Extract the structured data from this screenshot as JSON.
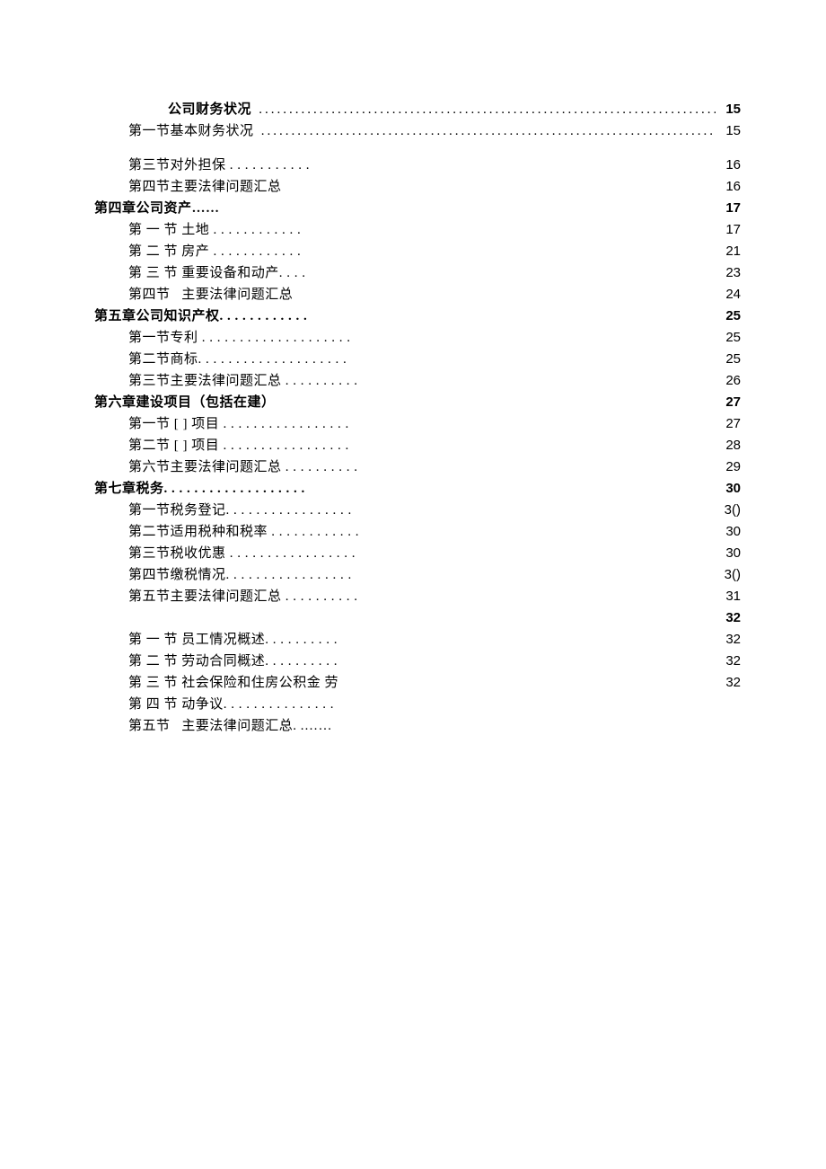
{
  "entries": [
    {
      "type": "main-center",
      "label": "公司财务状况 ",
      "leader": "full",
      "page": "15"
    },
    {
      "type": "sub-center",
      "label": "第一节基本财务状况 ",
      "leader": "full",
      "page": "15"
    },
    {
      "type": "spacer"
    },
    {
      "type": "sub",
      "label": "第三节对外担保 . . . . . . . . . . .",
      "leader": "short",
      "page": "16"
    },
    {
      "type": "sub",
      "label": "第四节主要法律问题汇总",
      "leader": "short",
      "page": "16"
    },
    {
      "type": "main",
      "label": "第四章公司资产……",
      "leader": "short",
      "page": "17"
    },
    {
      "type": "sub",
      "label": "第 一 节 土地 . . . . . . . . . . . .",
      "leader": "short",
      "page": "17"
    },
    {
      "type": "sub",
      "label": "第 二 节 房产 . . . . . . . . . . . .",
      "leader": "short",
      "page": "21"
    },
    {
      "type": "sub",
      "label": "第 三 节 重要设备和动产. . . .",
      "leader": "short",
      "page": "23"
    },
    {
      "type": "sub",
      "label": "第四节   主要法律问题汇总",
      "leader": "short",
      "page": "24"
    },
    {
      "type": "main",
      "label": "第五章公司知识产权. . . . . . . . . . . .",
      "leader": "short",
      "page": "25"
    },
    {
      "type": "sub",
      "label": "第一节专利 . . . . . . . . . . . . . . . . . . . .",
      "leader": "short",
      "page": "25"
    },
    {
      "type": "sub",
      "label": "第二节商标. . . . . . . . . . . . . . . . . . . .",
      "leader": "short",
      "page": "25"
    },
    {
      "type": "sub",
      "label": "第三节主要法律问题汇总 . . . . . . . . . .",
      "leader": "short",
      "page": "26"
    },
    {
      "type": "main",
      "label": "第六章建设项目（包括在建）",
      "leader": "short",
      "page": "27"
    },
    {
      "type": "sub",
      "label": "第一节 [ ] 项目 . . . . . . . . . . . . . . . . .",
      "leader": "short",
      "page": "27"
    },
    {
      "type": "sub",
      "label": "第二节 [ ] 项目 . . . . . . . . . . . . . . . . .",
      "leader": "short",
      "page": "28"
    },
    {
      "type": "sub",
      "label": "第六节主要法律问题汇总 . . . . . . . . . .",
      "leader": "short",
      "page": "29"
    },
    {
      "type": "main",
      "label": "第七章税务. . . . . . . . . . . . . . . . . . .",
      "leader": "short",
      "page": "30"
    },
    {
      "type": "sub",
      "label": "第一节税务登记. . . . . . . . . . . . . . . . .",
      "leader": "short",
      "page": "3()"
    },
    {
      "type": "sub",
      "label": "第二节适用税种和税率 . . . . . . . . . . . .",
      "leader": "short",
      "page": "30"
    },
    {
      "type": "sub",
      "label": "第三节税收优惠 . . . . . . . . . . . . . . . . .",
      "leader": "short",
      "page": "30"
    },
    {
      "type": "sub",
      "label": "第四节缴税情况. . . . . . . . . . . . . . . . .",
      "leader": "short",
      "page": "3()"
    },
    {
      "type": "sub",
      "label": "第五节主要法律问题汇总 . . . . . . . . . .",
      "leader": "short",
      "page": "31"
    },
    {
      "type": "main-stub",
      "label": "",
      "leader": "short",
      "page": "32"
    },
    {
      "type": "sub",
      "label": "第 一 节 员工情况概述. . . . . . . . . .",
      "leader": "short",
      "page": "32"
    },
    {
      "type": "sub",
      "label": "第 二 节 劳动合同概述. . . . . . . . . .",
      "leader": "short",
      "page": "32"
    },
    {
      "type": "sub",
      "label": "第 三 节 社会保险和住房公积金 劳",
      "leader": "short",
      "page": "32"
    },
    {
      "type": "sub",
      "label": "第 四 节 动争议. . . . . . . . . . . . . . .",
      "leader": "short",
      "page": ""
    },
    {
      "type": "sub",
      "label": "第五节   主要法律问题汇总. .……",
      "leader": "short",
      "page": ""
    }
  ]
}
